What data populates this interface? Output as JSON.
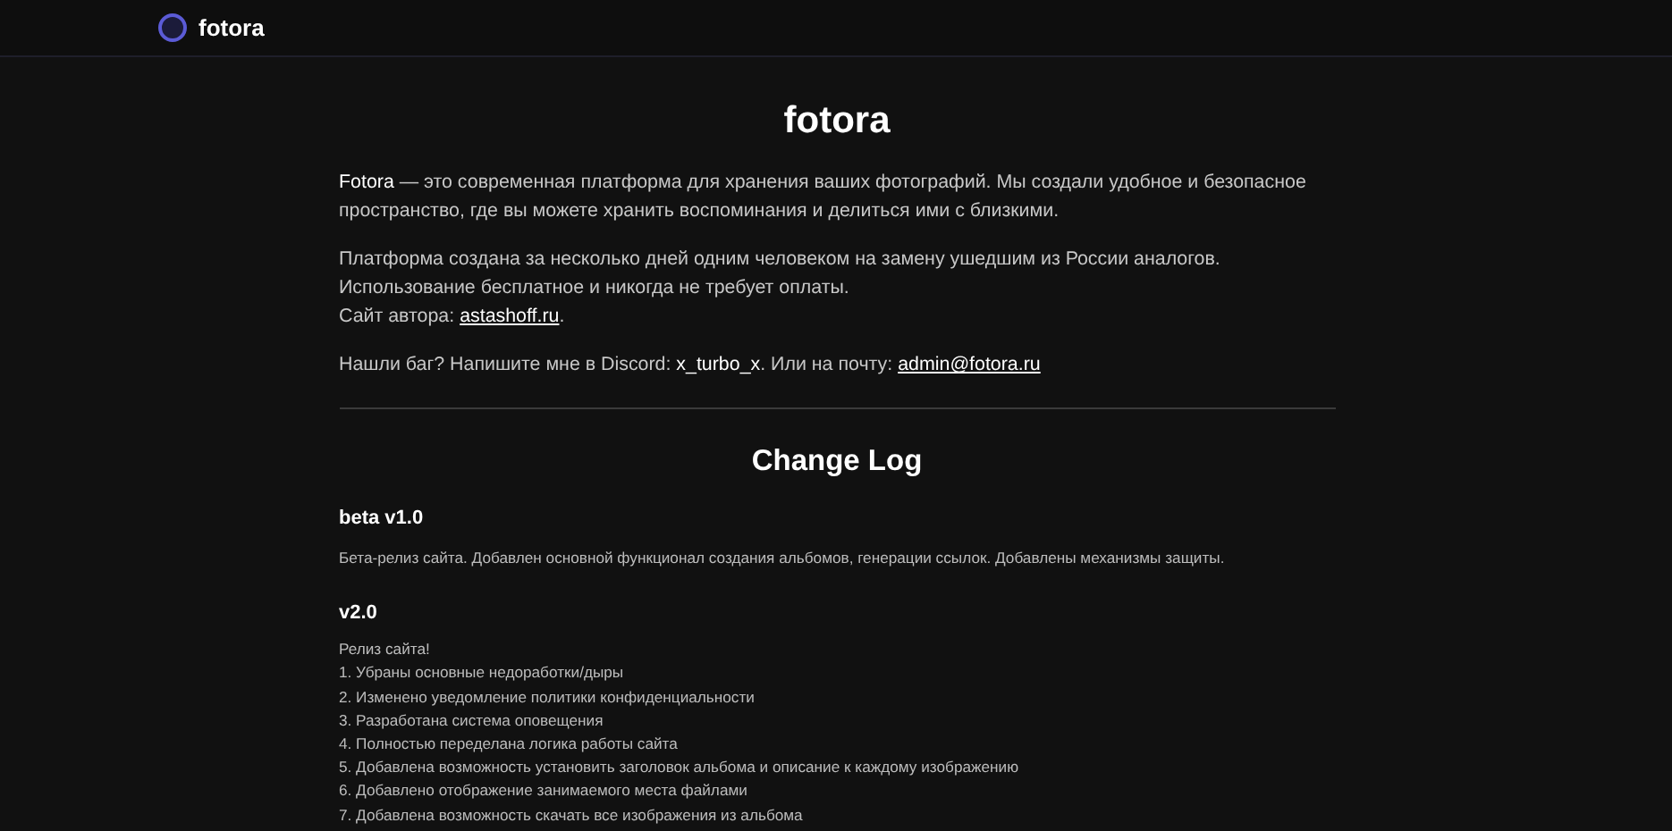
{
  "header": {
    "brand": "fotora"
  },
  "title": "fotora",
  "paragraphs": [
    {
      "lines": [
        [
          {
            "kind": "highlight",
            "text": "Fotora"
          },
          {
            "kind": "plain",
            "text": " — это современная платформа для хранения ваших фотографий. Мы создали удобное и безопасное пространство, где вы можете хранить воспоминания и делиться ими с близкими."
          }
        ]
      ]
    },
    {
      "lines": [
        [
          {
            "kind": "plain",
            "text": "Платформа создана за несколько дней одним человеком на замену ушедшим из России аналогов. Использование бесплатное и никогда не требует оплаты."
          }
        ],
        [
          {
            "kind": "plain",
            "text": "Сайт автора: "
          },
          {
            "kind": "link",
            "text": "astashoff.ru"
          },
          {
            "kind": "plain",
            "text": "."
          }
        ]
      ]
    },
    {
      "lines": [
        [
          {
            "kind": "plain",
            "text": "Нашли баг? Напишите мне в Discord: "
          },
          {
            "kind": "highlight",
            "text": "x_turbo_x"
          },
          {
            "kind": "plain",
            "text": ". Или на почту: "
          },
          {
            "kind": "link",
            "text": "admin@fotora.ru"
          }
        ]
      ]
    }
  ],
  "changelog": {
    "title": "Change Log",
    "versions": [
      {
        "version": "beta v1.0",
        "lines": [
          "Бета-релиз сайта. Добавлен основной функционал создания альбомов, генерации ссылок. Добавлены механизмы защиты."
        ]
      },
      {
        "version": "v2.0",
        "lines": [
          "Релиз сайта!",
          "1. Убраны основные недоработки/дыры",
          "2. Изменено уведомление политики конфиденциальности",
          "3. Разработана система оповещения",
          "4. Полностью переделана логика работы сайта",
          "5. Добавлена возможность установить заголовок альбома и описание к каждому изображению",
          "6. Добавлено отображение занимаемого места файлами",
          "7. Добавлена возможность скачать все изображения из альбома"
        ]
      }
    ]
  }
}
